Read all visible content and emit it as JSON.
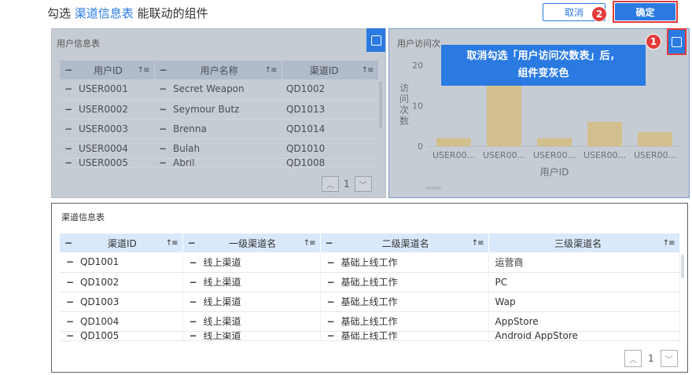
{
  "header": {
    "prefix": "勾选",
    "highlight": "渠道信息表",
    "suffix": "能联动的组件",
    "cancel_label": "取消",
    "ok_label": "确定",
    "badge_2": "2",
    "badge_1": "1"
  },
  "user_table": {
    "title": "用户信息表",
    "columns": [
      "用户ID",
      "用户名称",
      "渠道ID"
    ],
    "rows": [
      [
        "USER0001",
        "Secret Weapon",
        "QD1002"
      ],
      [
        "USER0002",
        "Seymour Butz",
        "QD1013"
      ],
      [
        "USER0003",
        "Brenna",
        "QD1014"
      ],
      [
        "USER0004",
        "Bulah",
        "QD1010"
      ],
      [
        "USER0005",
        "Abril",
        "QD1008"
      ]
    ],
    "page": "1"
  },
  "chart_panel": {
    "title": "用户访问次",
    "callout_line1": "取消勾选「用户访问次数表」后，",
    "callout_line2": "组件变灰色"
  },
  "chart_data": {
    "type": "bar",
    "categories": [
      "USER00...",
      "USER00...",
      "USER00...",
      "USER00...",
      "USER00..."
    ],
    "values": [
      2,
      19,
      2,
      6,
      3.5
    ],
    "ylabel": "访问次数",
    "xlabel": "用户ID",
    "ylim": [
      0,
      20
    ],
    "yticks": [
      "0",
      "10",
      "20"
    ],
    "bar_color": "#d3bf8e"
  },
  "channel_table": {
    "title": "渠道信息表",
    "columns": [
      "渠道ID",
      "一级渠道名",
      "二级渠道名",
      "三级渠道名"
    ],
    "rows": [
      [
        "QD1001",
        "线上渠道",
        "基础上线工作",
        "运营商"
      ],
      [
        "QD1002",
        "线上渠道",
        "基础上线工作",
        "PC"
      ],
      [
        "QD1003",
        "线上渠道",
        "基础上线工作",
        "Wap"
      ],
      [
        "QD1004",
        "线上渠道",
        "基础上线工作",
        "AppStore"
      ],
      [
        "QD1005",
        "线上渠道",
        "基础上线工作",
        "Android AppStore"
      ]
    ],
    "page": "1"
  },
  "colors": {
    "accent": "#2a7ae2",
    "danger": "#e23b3b",
    "disabled_panel": "#c6ccd3"
  }
}
